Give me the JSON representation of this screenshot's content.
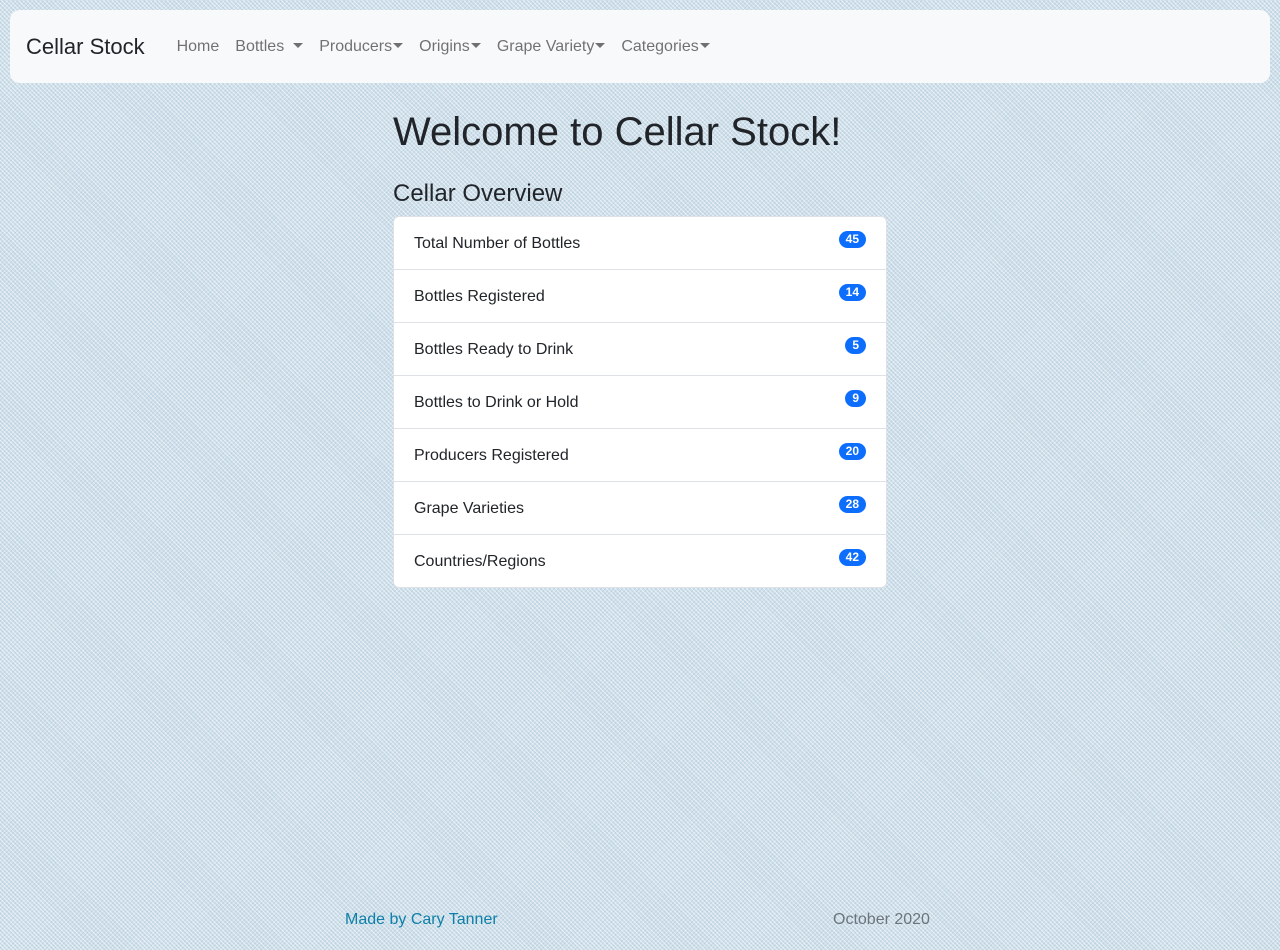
{
  "navbar": {
    "brand": "Cellar Stock",
    "items": [
      {
        "label": "Home",
        "dropdown": false
      },
      {
        "label": "Bottles",
        "dropdown": true
      },
      {
        "label": "Producers",
        "dropdown": true
      },
      {
        "label": "Origins",
        "dropdown": true
      },
      {
        "label": "Grape Variety",
        "dropdown": true
      },
      {
        "label": "Categories",
        "dropdown": true
      }
    ]
  },
  "main": {
    "title": "Welcome to Cellar Stock!",
    "overview_title": "Cellar Overview",
    "overview": [
      {
        "label": "Total Number of Bottles",
        "count": "45"
      },
      {
        "label": "Bottles Registered",
        "count": "14"
      },
      {
        "label": "Bottles Ready to Drink",
        "count": "5"
      },
      {
        "label": "Bottles to Drink or Hold",
        "count": "9"
      },
      {
        "label": "Producers Registered",
        "count": "20"
      },
      {
        "label": "Grape Varieties",
        "count": "28"
      },
      {
        "label": "Countries/Regions",
        "count": "42"
      }
    ]
  },
  "footer": {
    "credit": "Made by Cary Tanner",
    "date": "October 2020"
  },
  "colors": {
    "badge": "#0d6efd",
    "footer_link": "#0d7fa8",
    "navbar_bg": "#f8f9fa"
  }
}
